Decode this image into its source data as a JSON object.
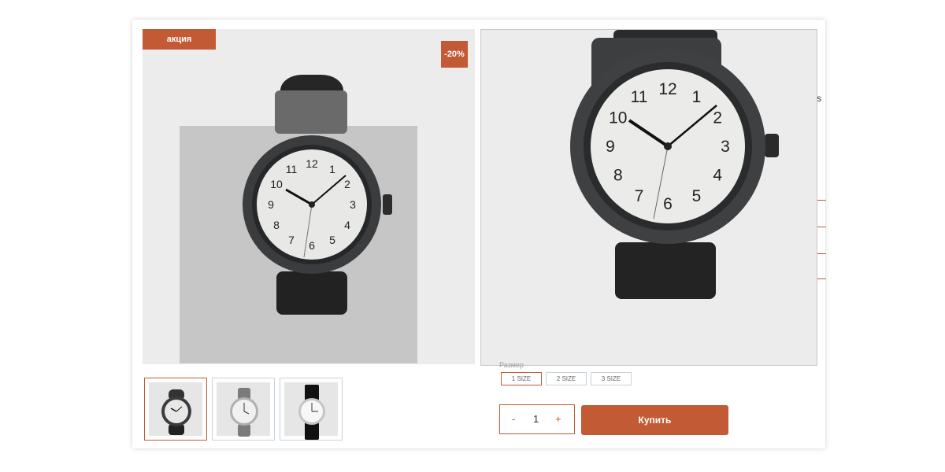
{
  "badges": {
    "sale": "акция",
    "discount": "-20%"
  },
  "gallery": {
    "thumbnails": [
      {
        "alt": "black watch",
        "active": true
      },
      {
        "alt": "grey watch",
        "active": false
      },
      {
        "alt": "black and white watch",
        "active": false
      }
    ]
  },
  "edge_text": "s",
  "sizes": {
    "label": "Размер",
    "options": [
      "1 SIZE",
      "2 SIZE",
      "3 SIZE"
    ],
    "selected": "1 SIZE"
  },
  "quantity": {
    "minus": "-",
    "value": "1",
    "plus": "+"
  },
  "buy_button": {
    "label": "Купить"
  },
  "watch_face_numbers": [
    "12",
    "1",
    "2",
    "3",
    "4",
    "5",
    "6",
    "7",
    "8",
    "9",
    "10",
    "11"
  ],
  "colors": {
    "accent": "#c15a35",
    "panel": "#ececec"
  }
}
